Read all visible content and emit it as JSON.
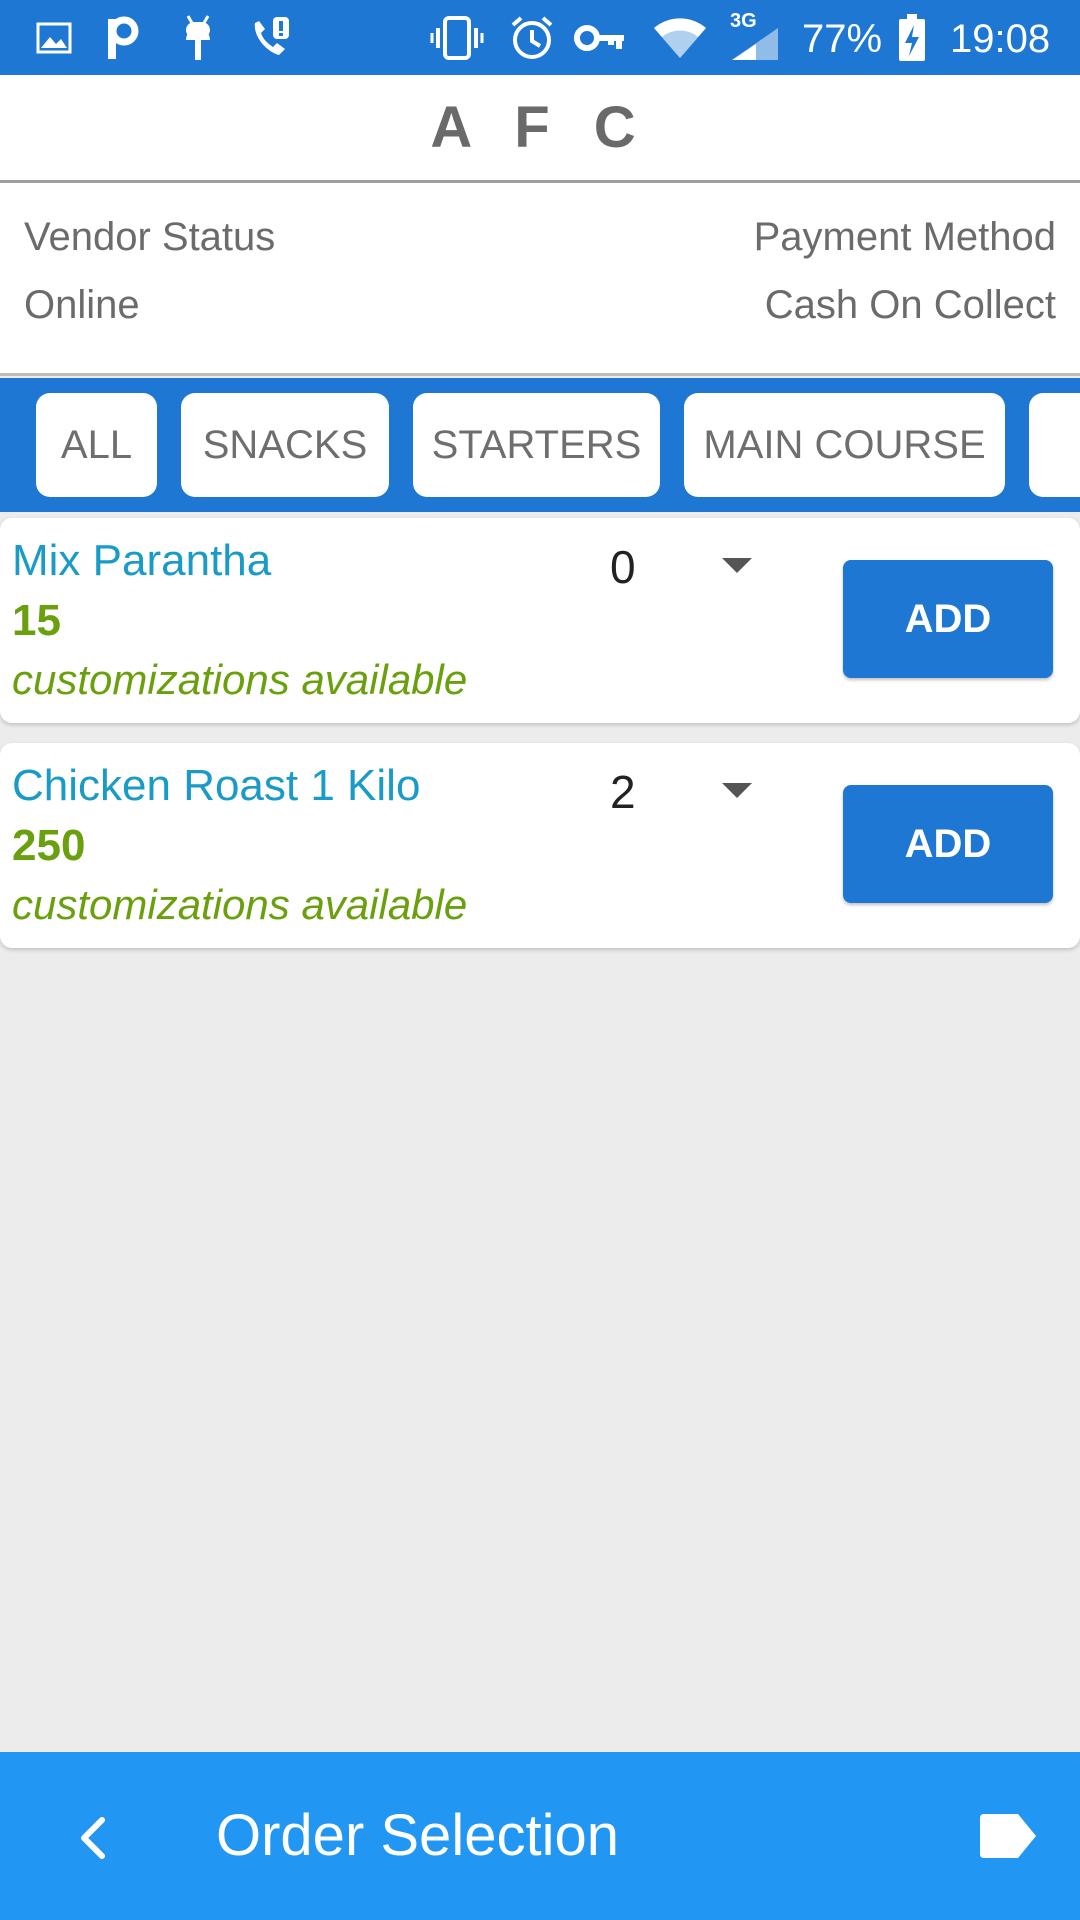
{
  "status_bar": {
    "battery": "77%",
    "time": "19:08",
    "network": "3G",
    "icons": [
      "image-icon",
      "p-icon",
      "android-icon",
      "call-alert-icon",
      "vibrate-icon",
      "alarm-icon",
      "vpn-key-icon",
      "wifi-icon",
      "signal-icon",
      "battery-charging-icon"
    ]
  },
  "header": {
    "title": "A F C"
  },
  "info": {
    "vendor_status_label": "Vendor Status",
    "vendor_status_value": "Online",
    "payment_method_label": "Payment Method",
    "payment_method_value": "Cash On Collect"
  },
  "categories": [
    "ALL",
    "SNACKS",
    "STARTERS",
    "MAIN COURSE"
  ],
  "items": [
    {
      "name": "Mix Parantha",
      "price": "15",
      "customizations": "customizations available",
      "qty": "0",
      "add_label": "ADD"
    },
    {
      "name": "Chicken Roast 1 Kilo",
      "price": "250",
      "customizations": "customizations available",
      "qty": "2",
      "add_label": "ADD"
    }
  ],
  "bottom_bar": {
    "title": "Order Selection"
  },
  "colors": {
    "primary": "#1e78d3",
    "bottom_bar": "#2196f3",
    "item_name": "#1a9bc7",
    "price": "#6aa00d"
  }
}
